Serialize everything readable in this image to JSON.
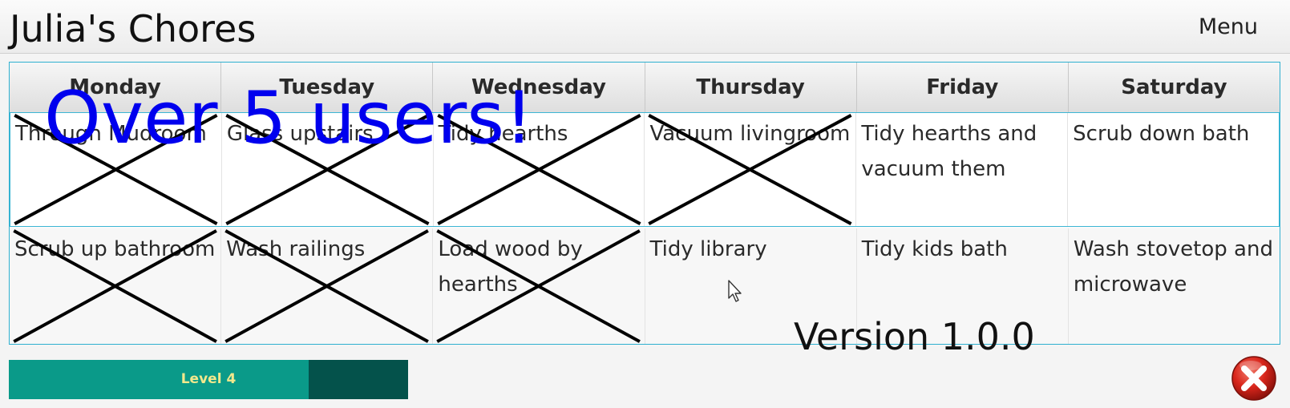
{
  "app": {
    "title": "Julia's Chores",
    "menu_label": "Menu"
  },
  "chores_table": {
    "days": [
      "Monday",
      "Tuesday",
      "Wednesday",
      "Thursday",
      "Friday",
      "Saturday"
    ],
    "rows": [
      [
        {
          "text": "Through Mudroom",
          "done": true
        },
        {
          "text": "Glass upstairs",
          "done": true
        },
        {
          "text": "Tidy hearths",
          "done": true
        },
        {
          "text": "Vacuum livingroom",
          "done": true
        },
        {
          "text": "Tidy hearths and vacuum them",
          "done": false
        },
        {
          "text": "Scrub down bath",
          "done": false
        }
      ],
      [
        {
          "text": "Scrub up bathroom",
          "done": true
        },
        {
          "text": "Wash railings",
          "done": true
        },
        {
          "text": "Load wood by hearths",
          "done": true
        },
        {
          "text": "Tidy library",
          "done": false
        },
        {
          "text": "Tidy kids bath",
          "done": false
        },
        {
          "text": "Wash stovetop and microwave",
          "done": false
        }
      ]
    ]
  },
  "overlay_text": "Over 5 users!",
  "version_text": "Version 1.0.0",
  "level": {
    "label": "Level 4",
    "progress": 0.75
  },
  "colors": {
    "accent_blue": "#0000ee",
    "table_border": "#2fb0d0",
    "level_fill": "#0a9a89",
    "level_track": "#04524b",
    "level_text": "#f2e88c",
    "close_red": "#d9261c"
  },
  "icons": {
    "close": "close-icon",
    "cursor": "mouse-cursor-icon",
    "cross": "cross-mark-icon"
  }
}
